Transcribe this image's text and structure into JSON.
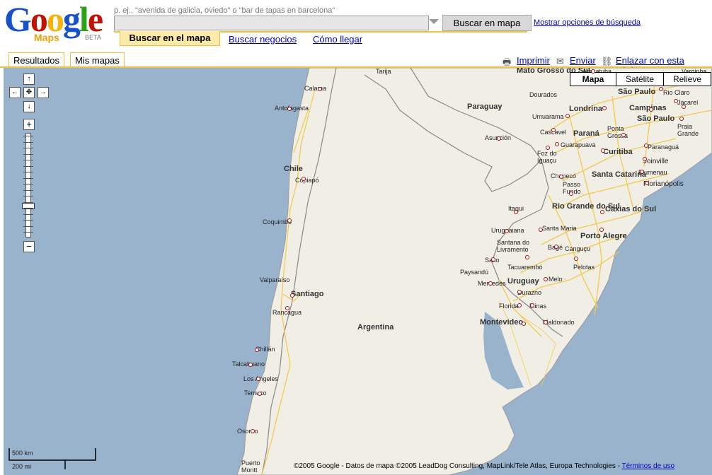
{
  "logo": {
    "letters": [
      "G",
      "o",
      "o",
      "g",
      "l",
      "e"
    ],
    "maps": "Maps",
    "beta": "BETA"
  },
  "search": {
    "hint": "p. ej., \"avenida de galicia, oviedo\" o \"bar de tapas en barcelona\"",
    "value": "",
    "button": "Buscar en mapa",
    "options_link": "Mostrar opciones de búsqueda"
  },
  "modes": {
    "search": "Buscar en el mapa",
    "business": "Buscar negocios",
    "directions": "Cómo llegar"
  },
  "panel_tabs": {
    "results": "Resultados",
    "mymaps": "Mis mapas"
  },
  "actions": {
    "print": "Imprimir",
    "send": "Enviar",
    "link": "Enlazar con esta página",
    "print_icon": "printer-icon",
    "send_icon": "envelope-icon",
    "link_icon": "chain-link-icon"
  },
  "map_types": {
    "map": "Mapa",
    "satellite": "Satélite",
    "relief": "Relieve"
  },
  "controls": {
    "up": "↑",
    "down": "↓",
    "left": "←",
    "right": "→",
    "center": "✥",
    "zoom_in": "+",
    "zoom_out": "−"
  },
  "scale": {
    "km": "500 km",
    "mi": "200 mi"
  },
  "copyright": {
    "text": "©2005 Google - Datos de mapa ©2005 LeadDog Consulting, MapLink/Tele Atlas, Europa Technologies - ",
    "terms": "Términos de uso"
  },
  "places": [
    {
      "name": "Tarija"
    },
    {
      "name": "Calama"
    },
    {
      "name": "Antofagasta"
    },
    {
      "name": "Chile"
    },
    {
      "name": "Copiapó"
    },
    {
      "name": "Coquimbo"
    },
    {
      "name": "Valparaíso"
    },
    {
      "name": "Santiago"
    },
    {
      "name": "Rancagua"
    },
    {
      "name": "Chillán"
    },
    {
      "name": "Talcahuano"
    },
    {
      "name": "Los Angeles"
    },
    {
      "name": "Temuco"
    },
    {
      "name": "Osorno"
    },
    {
      "name": "Puerto Montt"
    },
    {
      "name": "Paraguay"
    },
    {
      "name": "Asunción"
    },
    {
      "name": "Argentina"
    },
    {
      "name": "Uruguay"
    },
    {
      "name": "Montevideo"
    },
    {
      "name": "Maldonado"
    },
    {
      "name": "Florida"
    },
    {
      "name": "Minas"
    },
    {
      "name": "Mercedes"
    },
    {
      "name": "Durazno"
    },
    {
      "name": "Paysandú"
    },
    {
      "name": "Salto"
    },
    {
      "name": "Tacuarembó"
    },
    {
      "name": "Melo"
    },
    {
      "name": "Santana do Livramento"
    },
    {
      "name": "Uruguaiana"
    },
    {
      "name": "Itaqui"
    },
    {
      "name": "Santa Maria"
    },
    {
      "name": "Rio Grande do Sul"
    },
    {
      "name": "Caxias do Sul"
    },
    {
      "name": "Porto Alegre"
    },
    {
      "name": "Bagé"
    },
    {
      "name": "Canguçu"
    },
    {
      "name": "Pelotas"
    },
    {
      "name": "Chapecó"
    },
    {
      "name": "Passo Fundo"
    },
    {
      "name": "Santa Catarina"
    },
    {
      "name": "Florianópolis"
    },
    {
      "name": "Blumenau"
    },
    {
      "name": "Joinville"
    },
    {
      "name": "Curitiba"
    },
    {
      "name": "Paranaguá"
    },
    {
      "name": "Paraná"
    },
    {
      "name": "Ponta Grossa"
    },
    {
      "name": "Guarapuava"
    },
    {
      "name": "Cascavel"
    },
    {
      "name": "Foz do Iguaçu"
    },
    {
      "name": "Umuarama"
    },
    {
      "name": "Londrina"
    },
    {
      "name": "Campinas"
    },
    {
      "name": "São Paulo"
    },
    {
      "name": "Jacareí"
    },
    {
      "name": "Praia Grande"
    },
    {
      "name": "Rio Claro"
    },
    {
      "name": "Mato Grosso do Sul"
    },
    {
      "name": "Dourados"
    },
    {
      "name": "Araçatuba"
    },
    {
      "name": "Varginha"
    }
  ]
}
